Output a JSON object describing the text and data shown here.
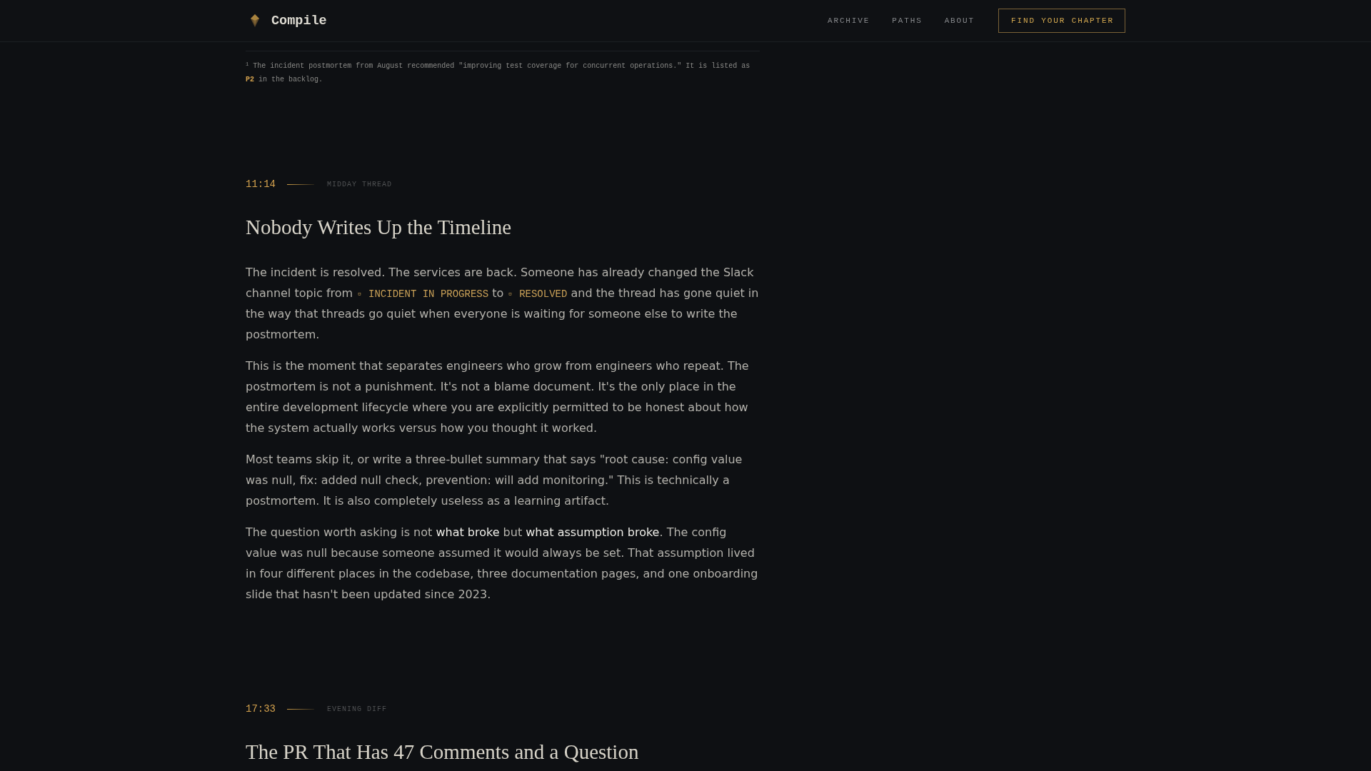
{
  "header": {
    "brand": "Compile",
    "nav": [
      "ARCHIVE",
      "PATHS",
      "ABOUT"
    ],
    "cta": "FIND YOUR CHAPTER"
  },
  "footnotes": [
    "$^{1}$ The incident postmortem from August recommended \"improving test coverage for concurrent operations.\" It is listed as **P2** in the backlog."
  ],
  "sections": [
    {
      "time": "11:14",
      "label": "MIDDAY THREAD",
      "title": "Nobody Writes Up the Timeline",
      "paragraphs": [
        [
          {
            "kind": "text",
            "text": "The incident is resolved. The services are back. Someone has already changed the Slack channel topic from "
          },
          {
            "kind": "code",
            "text": "▫ INCIDENT IN PROGRESS"
          },
          {
            "kind": "text",
            "text": " to "
          },
          {
            "kind": "code",
            "text": "▫ RESOLVED"
          },
          {
            "kind": "text",
            "text": " and the thread has gone quiet in the way that threads go quiet when everyone is waiting for someone else to write the postmortem."
          }
        ],
        [
          {
            "kind": "text",
            "text": "This is the moment that separates engineers who grow from engineers who repeat. The postmortem is not a punishment. It's not a blame document. It's the only place in the entire development lifecycle where you are explicitly permitted to be honest about how the system actually works versus how you thought it worked."
          }
        ],
        [
          {
            "kind": "text",
            "text": "Most teams skip it, or write a three-bullet summary that says \"root cause: config value was null, fix: added null check, prevention: will add monitoring.\" This is technically a postmortem. It is also completely useless as a learning artifact."
          }
        ],
        [
          {
            "kind": "text",
            "text": "The question worth asking is not **what broke** but **what assumption broke**. The config value was null because someone assumed it would always be set. That assumption lived in four different places in the codebase, three documentation pages, and one onboarding slide that hasn't been updated since 2023."
          }
        ]
      ]
    },
    {
      "time": "17:33",
      "label": "EVENING DIFF",
      "title": "The PR That Has 47 Comments and a Question"
    }
  ]
}
